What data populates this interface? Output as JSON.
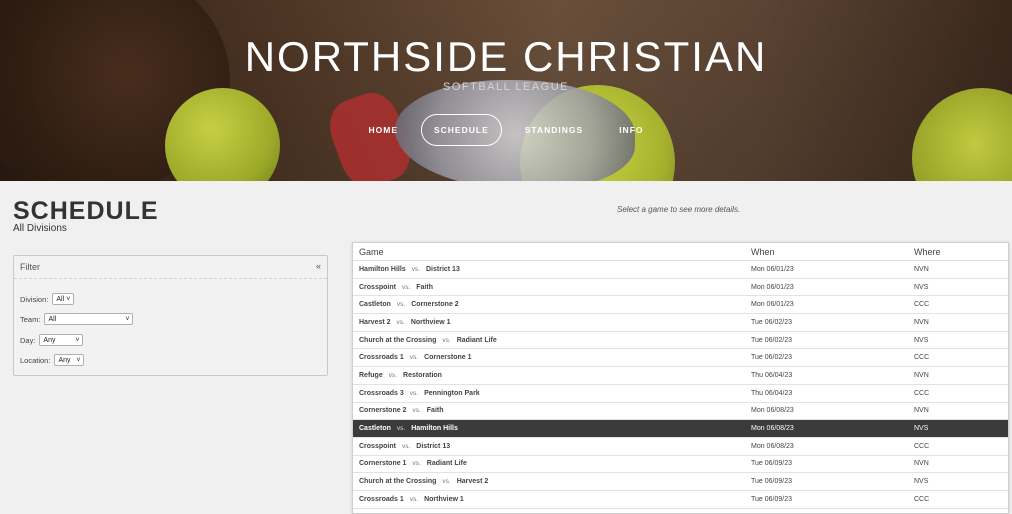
{
  "header": {
    "title": "NORTHSIDE CHRISTIAN",
    "subtitle": "SOFTBALL LEAGUE",
    "nav": [
      "HOME",
      "SCHEDULE",
      "STANDINGS",
      "INFO"
    ]
  },
  "page": {
    "title": "SCHEDULE",
    "subtitle": "All Divisions",
    "hint": "Select a game to see more details."
  },
  "filter": {
    "title": "Filter",
    "division_label": "Division:",
    "division_value": "All",
    "team_label": "Team:",
    "team_value": "All",
    "day_label": "Day:",
    "day_value": "Any",
    "location_label": "Location:",
    "location_value": "Any"
  },
  "table": {
    "headers": {
      "game": "Game",
      "when": "When",
      "where": "Where"
    },
    "vs": "vs.",
    "rows": [
      {
        "home": "Hamilton Hills",
        "away": "District 13",
        "when": "Mon 06/01/23",
        "where": "NVN"
      },
      {
        "home": "Crosspoint",
        "away": "Faith",
        "when": "Mon 06/01/23",
        "where": "NVS"
      },
      {
        "home": "Castleton",
        "away": "Cornerstone 2",
        "when": "Mon 06/01/23",
        "where": "CCC"
      },
      {
        "home": "Harvest 2",
        "away": "Northview 1",
        "when": "Tue 06/02/23",
        "where": "NVN"
      },
      {
        "home": "Church at the Crossing",
        "away": "Radiant Life",
        "when": "Tue 06/02/23",
        "where": "NVS"
      },
      {
        "home": "Crossroads 1",
        "away": "Cornerstone 1",
        "when": "Tue 06/02/23",
        "where": "CCC"
      },
      {
        "home": "Refuge",
        "away": "Restoration",
        "when": "Thu 06/04/23",
        "where": "NVN"
      },
      {
        "home": "Crossroads 3",
        "away": "Pennington Park",
        "when": "Thu 06/04/23",
        "where": "CCC"
      },
      {
        "home": "Cornerstone 2",
        "away": "Faith",
        "when": "Mon 06/08/23",
        "where": "NVN"
      },
      {
        "home": "Castleton",
        "away": "Hamilton Hills",
        "when": "Mon 06/08/23",
        "where": "NVS",
        "selected": true
      },
      {
        "home": "Crosspoint",
        "away": "District 13",
        "when": "Mon 06/08/23",
        "where": "CCC"
      },
      {
        "home": "Cornerstone 1",
        "away": "Radiant Life",
        "when": "Tue 06/09/23",
        "where": "NVN"
      },
      {
        "home": "Church at the Crossing",
        "away": "Harvest 2",
        "when": "Tue 06/09/23",
        "where": "NVS"
      },
      {
        "home": "Crossroads 1",
        "away": "Northview 1",
        "when": "Tue 06/09/23",
        "where": "CCC"
      }
    ]
  }
}
